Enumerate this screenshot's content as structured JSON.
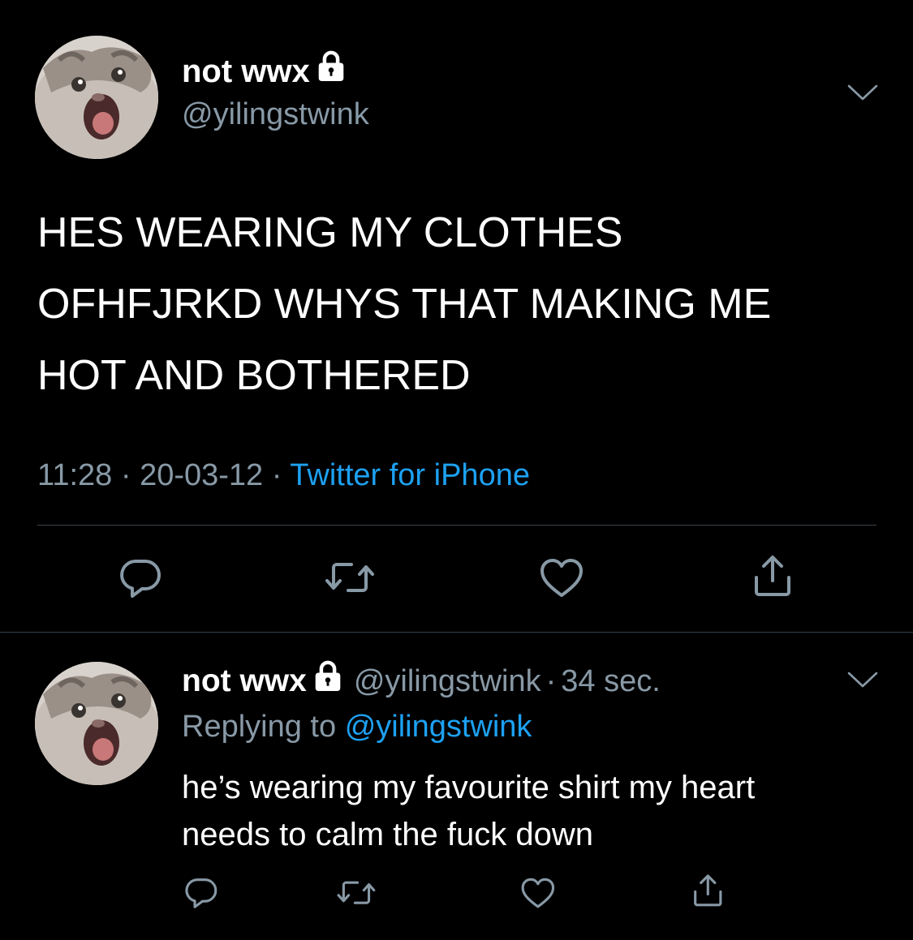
{
  "colors": {
    "background": "#000000",
    "text": "#ffffff",
    "secondary": "#8899a6",
    "accent": "#1da1f2",
    "divider": "#38444d"
  },
  "main_tweet": {
    "display_name": "not wwx",
    "handle": "@yilingstwink",
    "text_lines": [
      "HES WEARING MY CLOTHES",
      "OFHFJRKD WHYS THAT MAKING ME",
      "HOT AND BOTHERED"
    ],
    "time": "11:28",
    "separator": "·",
    "date": "20-03-12",
    "source": "Twitter for iPhone",
    "icons": [
      "avatar-cat",
      "lock-icon",
      "chevron-down-icon",
      "reply-icon",
      "retweet-icon",
      "like-icon",
      "share-icon"
    ]
  },
  "reply_tweet": {
    "display_name": "not wwx",
    "handle": "@yilingstwink",
    "dot": "·",
    "time_ago": "34 sec.",
    "replying_prefix": "Replying to",
    "replying_to": "@yilingstwink",
    "text_lines": [
      "he’s wearing my favourite shirt my heart",
      "needs to calm the fuck down"
    ],
    "icons": [
      "avatar-cat",
      "lock-icon",
      "chevron-down-icon",
      "reply-icon",
      "retweet-icon",
      "like-icon",
      "share-icon"
    ]
  }
}
